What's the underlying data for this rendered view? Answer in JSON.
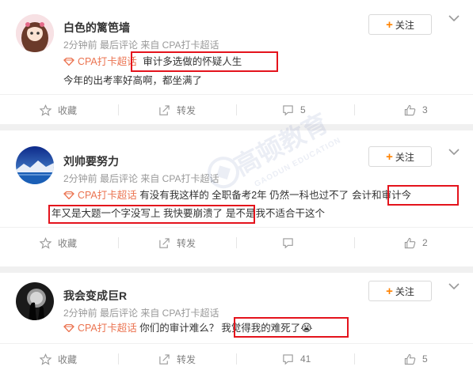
{
  "posts": [
    {
      "name": "白色的篱笆墙",
      "meta": "2分钟前 最后评论 来自 CPA打卡超话",
      "follow_label": "关注",
      "topic": "CPA打卡超话",
      "text_highlight": "审计多选做的怀疑人生",
      "text2": "今年的出考率好高啊，都坐满了",
      "actions": {
        "favorite": "收藏",
        "forward": "转发",
        "comments": "5",
        "likes": "3"
      }
    },
    {
      "name": "刘帅要努力",
      "meta": "2分钟前 最后评论 来自 CPA打卡超话",
      "follow_label": "关注",
      "topic": "CPA打卡超话",
      "text_a": " 有没有我这样的 全职备考2年 仍然一科也过不了",
      "text_hl1": "会计和审计今",
      "text_hl2": "年又是大题一个字没写上 我快要崩溃了",
      "text_b": "是不是我不适合干这个",
      "actions": {
        "favorite": "收藏",
        "forward": "转发",
        "comments": "",
        "likes": "2"
      }
    },
    {
      "name": "我会变成巨R",
      "meta": "2分钟前 最后评论 来自 CPA打卡超话",
      "follow_label": "关注",
      "topic": "CPA打卡超话",
      "text_a": " 你们的审计难么？",
      "text_hl": "我觉得我的难死了",
      "emoji": "😭",
      "actions": {
        "favorite": "收藏",
        "forward": "转发",
        "comments": "41",
        "likes": "5"
      }
    }
  ],
  "watermark": {
    "cn": "高顿教育",
    "en": "GAODUN EDUCATION"
  },
  "colors": {
    "topic": "#eb7350",
    "highlight": "#e4131c",
    "follow_plus": "#ff8200"
  }
}
